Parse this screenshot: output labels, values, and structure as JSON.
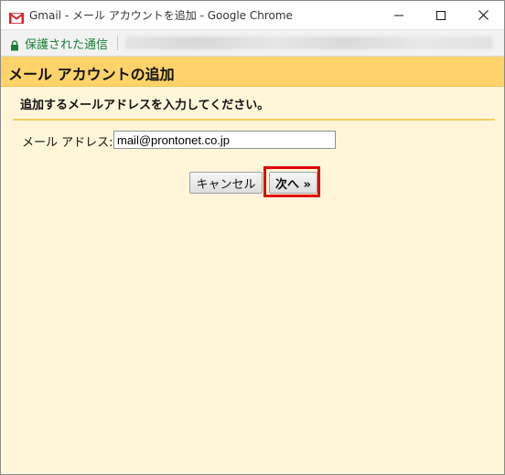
{
  "window": {
    "title": "Gmail - メール アカウントを追加 - Google Chrome",
    "controls": {
      "minimize": "—",
      "maximize": "☐",
      "close": "✕"
    }
  },
  "addressbar": {
    "secure_label": "保護された通信",
    "lock_icon": "lock-icon",
    "url_blurred": true
  },
  "page": {
    "title": "メール アカウントの追加",
    "instruction": "追加するメールアドレスを入力してください。",
    "email_label": "メール アドレス:",
    "email_value": "mail@prontonet.co.jp",
    "cancel_label": "キャンセル",
    "next_label": "次へ »"
  },
  "colors": {
    "header_bg": "#ffd36a",
    "page_bg": "#fff6d9",
    "highlight": "#e00000",
    "secure_green": "#188038"
  }
}
